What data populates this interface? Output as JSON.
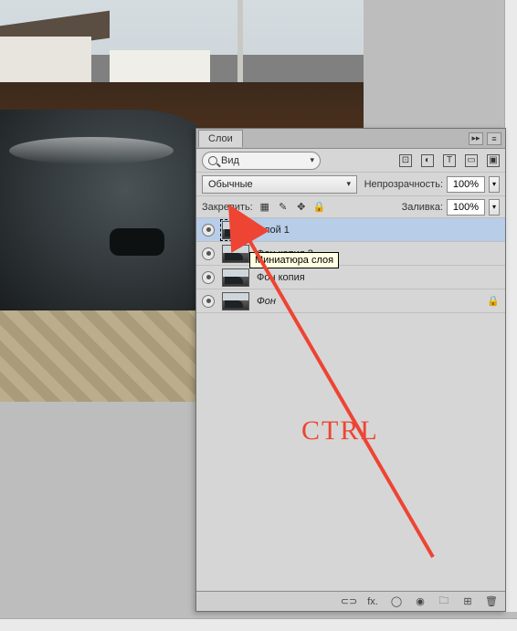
{
  "panel": {
    "tab_label": "Слои",
    "collapse_glyph": "▸▸",
    "menu_glyph": "≡"
  },
  "search": {
    "label": "Вид"
  },
  "filter_icons": {
    "pixel": "⊡",
    "adjust": "◐",
    "type": "T",
    "shape": "▭",
    "smart": "▣"
  },
  "blend": {
    "mode": "Обычные",
    "opacity_label": "Непрозрачность:",
    "opacity_value": "100%",
    "step_glyph": "▾"
  },
  "lock": {
    "label": "Закрепить:",
    "transp": "▦",
    "brush": "✎",
    "move": "✥",
    "all": "🔒",
    "fill_label": "Заливка:",
    "fill_value": "100%"
  },
  "layers": [
    {
      "name": "Слой 1",
      "selected": true,
      "italic": false,
      "locked": false
    },
    {
      "name": "Фон копия 2",
      "selected": false,
      "italic": false,
      "locked": false
    },
    {
      "name": "Фон копия",
      "selected": false,
      "italic": false,
      "locked": false
    },
    {
      "name": "Фон",
      "selected": false,
      "italic": true,
      "locked": true
    }
  ],
  "tooltip": {
    "text": "Миниатюра слоя"
  },
  "footer": {
    "link": "⊂⊃",
    "fx": "fx.",
    "mask": "◯",
    "adjust": "◉",
    "folder": "🗀",
    "new": "⊞",
    "trash": "🗑"
  },
  "annotation": {
    "ctrl": "CTRL"
  }
}
